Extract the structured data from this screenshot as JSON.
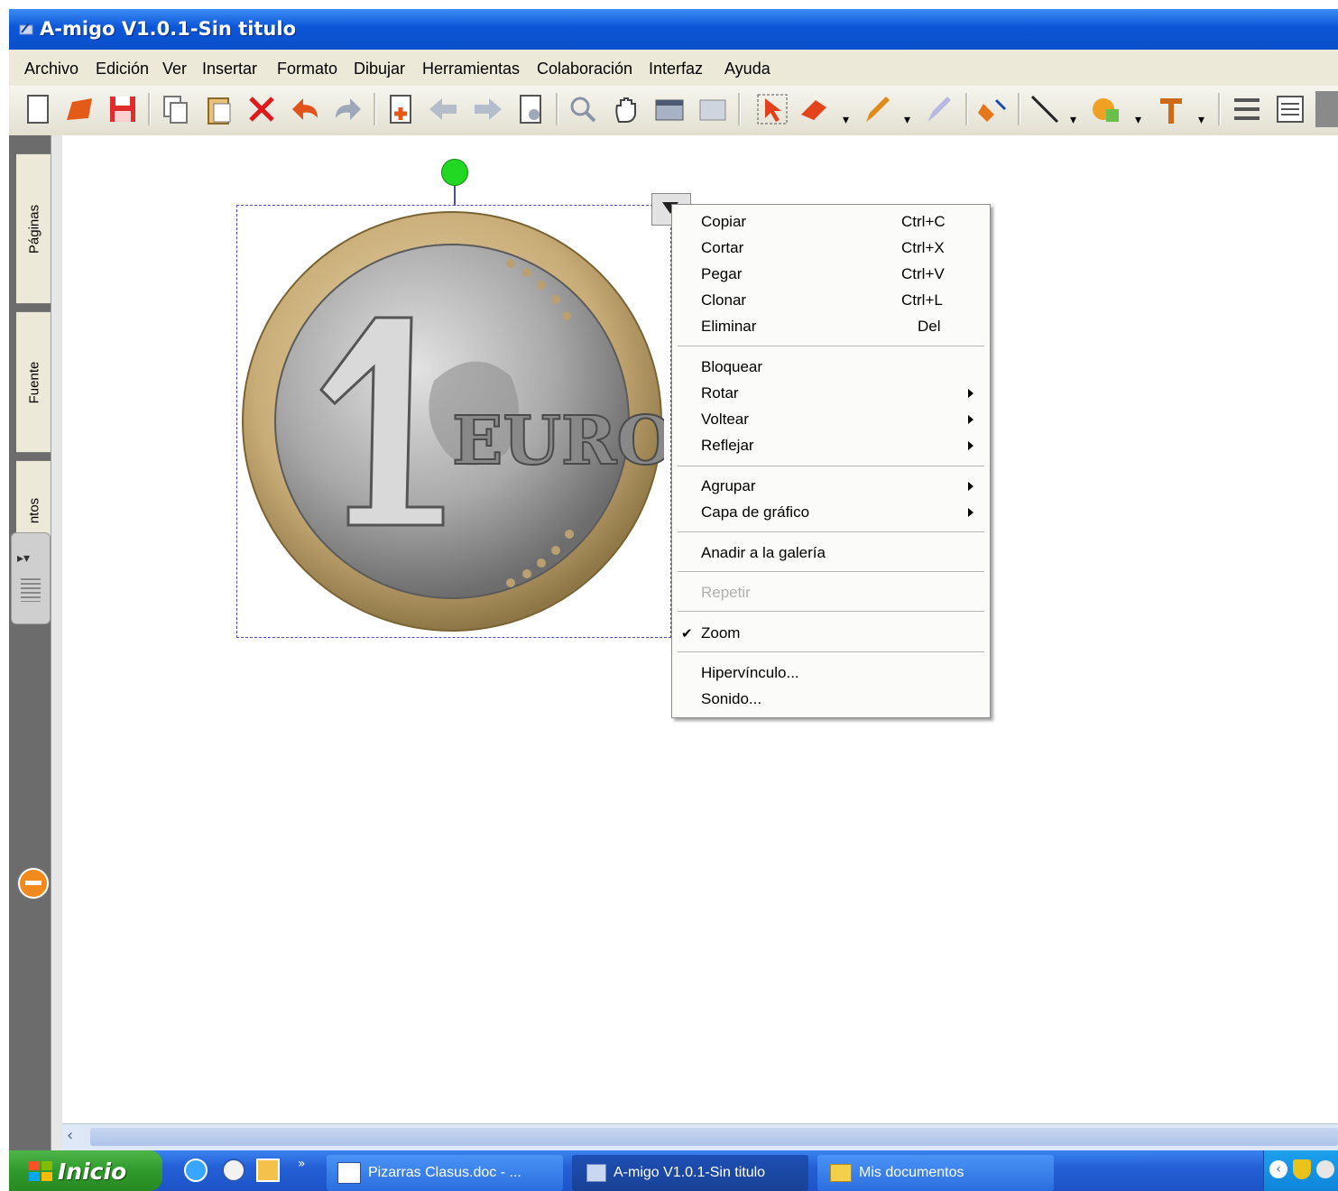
{
  "window": {
    "title": "A-migo V1.0.1-Sin titulo"
  },
  "menubar": {
    "items": [
      {
        "label": "Archivo"
      },
      {
        "label": "Edición"
      },
      {
        "label": "Ver"
      },
      {
        "label": "Insertar"
      },
      {
        "label": "Formato"
      },
      {
        "label": "Dibujar"
      },
      {
        "label": "Herramientas"
      },
      {
        "label": "Colaboración"
      },
      {
        "label": "Interfaz"
      },
      {
        "label": "Ayuda"
      }
    ]
  },
  "toolbar": {
    "icons": [
      "new-page-icon",
      "open-icon",
      "save-icon",
      "copy-icon",
      "paste-icon",
      "delete-icon",
      "undo-icon",
      "redo-icon",
      "insert-page-icon",
      "prev-page-icon",
      "next-page-icon",
      "page-settings-icon",
      "zoom-icon",
      "hand-icon",
      "screen-icon",
      "shade-icon",
      "select-icon",
      "eraser-icon",
      "pen-icon",
      "highlighter-icon",
      "fill-icon",
      "line-icon",
      "shape-icon",
      "text-icon",
      "align-icon",
      "list-icon"
    ]
  },
  "sidetabs": {
    "pages": "Páginas",
    "font": "Fuente",
    "objects": "ntos"
  },
  "context_menu": {
    "group1": [
      {
        "label": "Copiar",
        "shortcut": "Ctrl+C"
      },
      {
        "label": "Cortar",
        "shortcut": "Ctrl+X"
      },
      {
        "label": "Pegar",
        "shortcut": "Ctrl+V"
      },
      {
        "label": "Clonar",
        "shortcut": "Ctrl+L"
      },
      {
        "label": "Eliminar",
        "shortcut": "Del"
      }
    ],
    "group2": [
      {
        "label": "Bloquear"
      },
      {
        "label": "Rotar"
      },
      {
        "label": "Voltear"
      },
      {
        "label": "Reflejar"
      }
    ],
    "group3": [
      {
        "label": "Agrupar"
      },
      {
        "label": "Capa de gráfico"
      }
    ],
    "gallery": "Anadir a la galería",
    "repeat": "Repetir",
    "zoom": "Zoom",
    "group4": [
      {
        "label": "Hipervínculo..."
      },
      {
        "label": "Sonido..."
      }
    ]
  },
  "taskbar": {
    "start": "Inicio",
    "tasks": [
      {
        "label": "Pizarras Clasus.doc - ..."
      },
      {
        "label": "A-migo V1.0.1-Sin titulo"
      },
      {
        "label": "Mis documentos"
      }
    ]
  },
  "colors": {
    "titlebar": "#0b56d8",
    "menu_bg": "#ece9d8",
    "selection": "#4a4ad0",
    "rotate_handle": "#22d822",
    "taskbar": "#2460d6",
    "start_button": "#2f9a2b"
  }
}
